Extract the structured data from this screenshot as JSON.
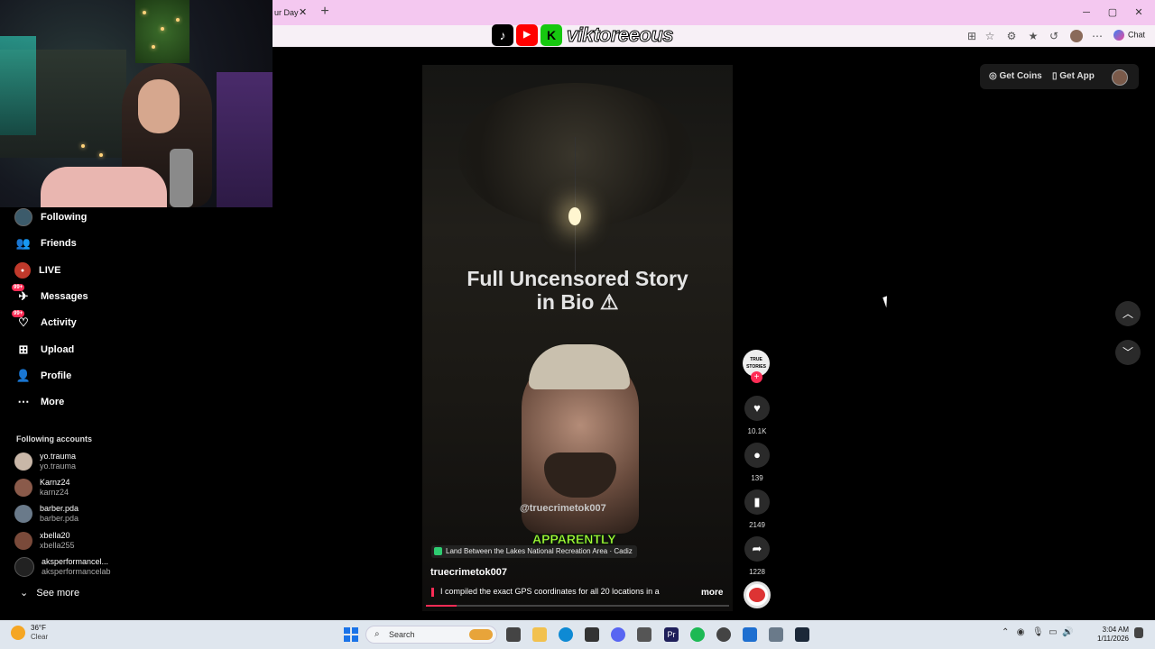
{
  "browser": {
    "tab_title": "ur Day",
    "tab_close": "✕",
    "new_tab": "+",
    "chat_label": "Chat",
    "window_controls": [
      "─",
      "▢",
      "✕"
    ]
  },
  "overlay": {
    "brand_name": "viktoreeous",
    "brand_icons": [
      "tiktok-icon",
      "youtube-icon",
      "kick-icon"
    ],
    "brand_k": "K"
  },
  "header": {
    "get_coins": "Get Coins",
    "get_app": "Get App"
  },
  "sidebar": {
    "items": [
      {
        "label": "Following",
        "icon": "avatar-icon"
      },
      {
        "label": "Friends",
        "icon": "friends-icon"
      },
      {
        "label": "LIVE",
        "icon": "live-icon"
      },
      {
        "label": "Messages",
        "icon": "messages-icon",
        "badge": "99+"
      },
      {
        "label": "Activity",
        "icon": "activity-icon",
        "badge": "99+"
      },
      {
        "label": "Upload",
        "icon": "upload-icon"
      },
      {
        "label": "Profile",
        "icon": "profile-icon"
      },
      {
        "label": "More",
        "icon": "more-icon"
      }
    ],
    "following_header": "Following accounts",
    "accounts": [
      {
        "name": "yo.trauma",
        "handle": "yo.trauma"
      },
      {
        "name": "Karnz24",
        "handle": "karnz24"
      },
      {
        "name": "barber.pda",
        "handle": "barber.pda"
      },
      {
        "name": "xbella20",
        "handle": "xbella255"
      },
      {
        "name": "aksperformancel...",
        "handle": "aksperformancelab"
      }
    ],
    "see_more": "See more"
  },
  "video": {
    "overlay_title_line1": "Full Uncensored Story",
    "overlay_title_line2": "in Bio ⚠",
    "watermark_handle": "@truecrimetok007",
    "caption_overlay": "APPARENTLY",
    "location": "Land Between the Lakes National Recreation Area · Cadiz",
    "author": "truecrimetok007",
    "caption": "I compiled the exact GPS coordinates for all 20 locations in a",
    "more_label": "more",
    "progress_fraction": 0.1,
    "creator_avatar_text": "TRUE STORIES"
  },
  "actions": {
    "likes": "10.1K",
    "comments": "139",
    "saves": "2149",
    "shares": "1228"
  },
  "taskbar": {
    "weather_temp": "36°F",
    "weather_desc": "Clear",
    "search_label": "Search",
    "time": "3:04 AM",
    "date": "1/11/2026"
  }
}
